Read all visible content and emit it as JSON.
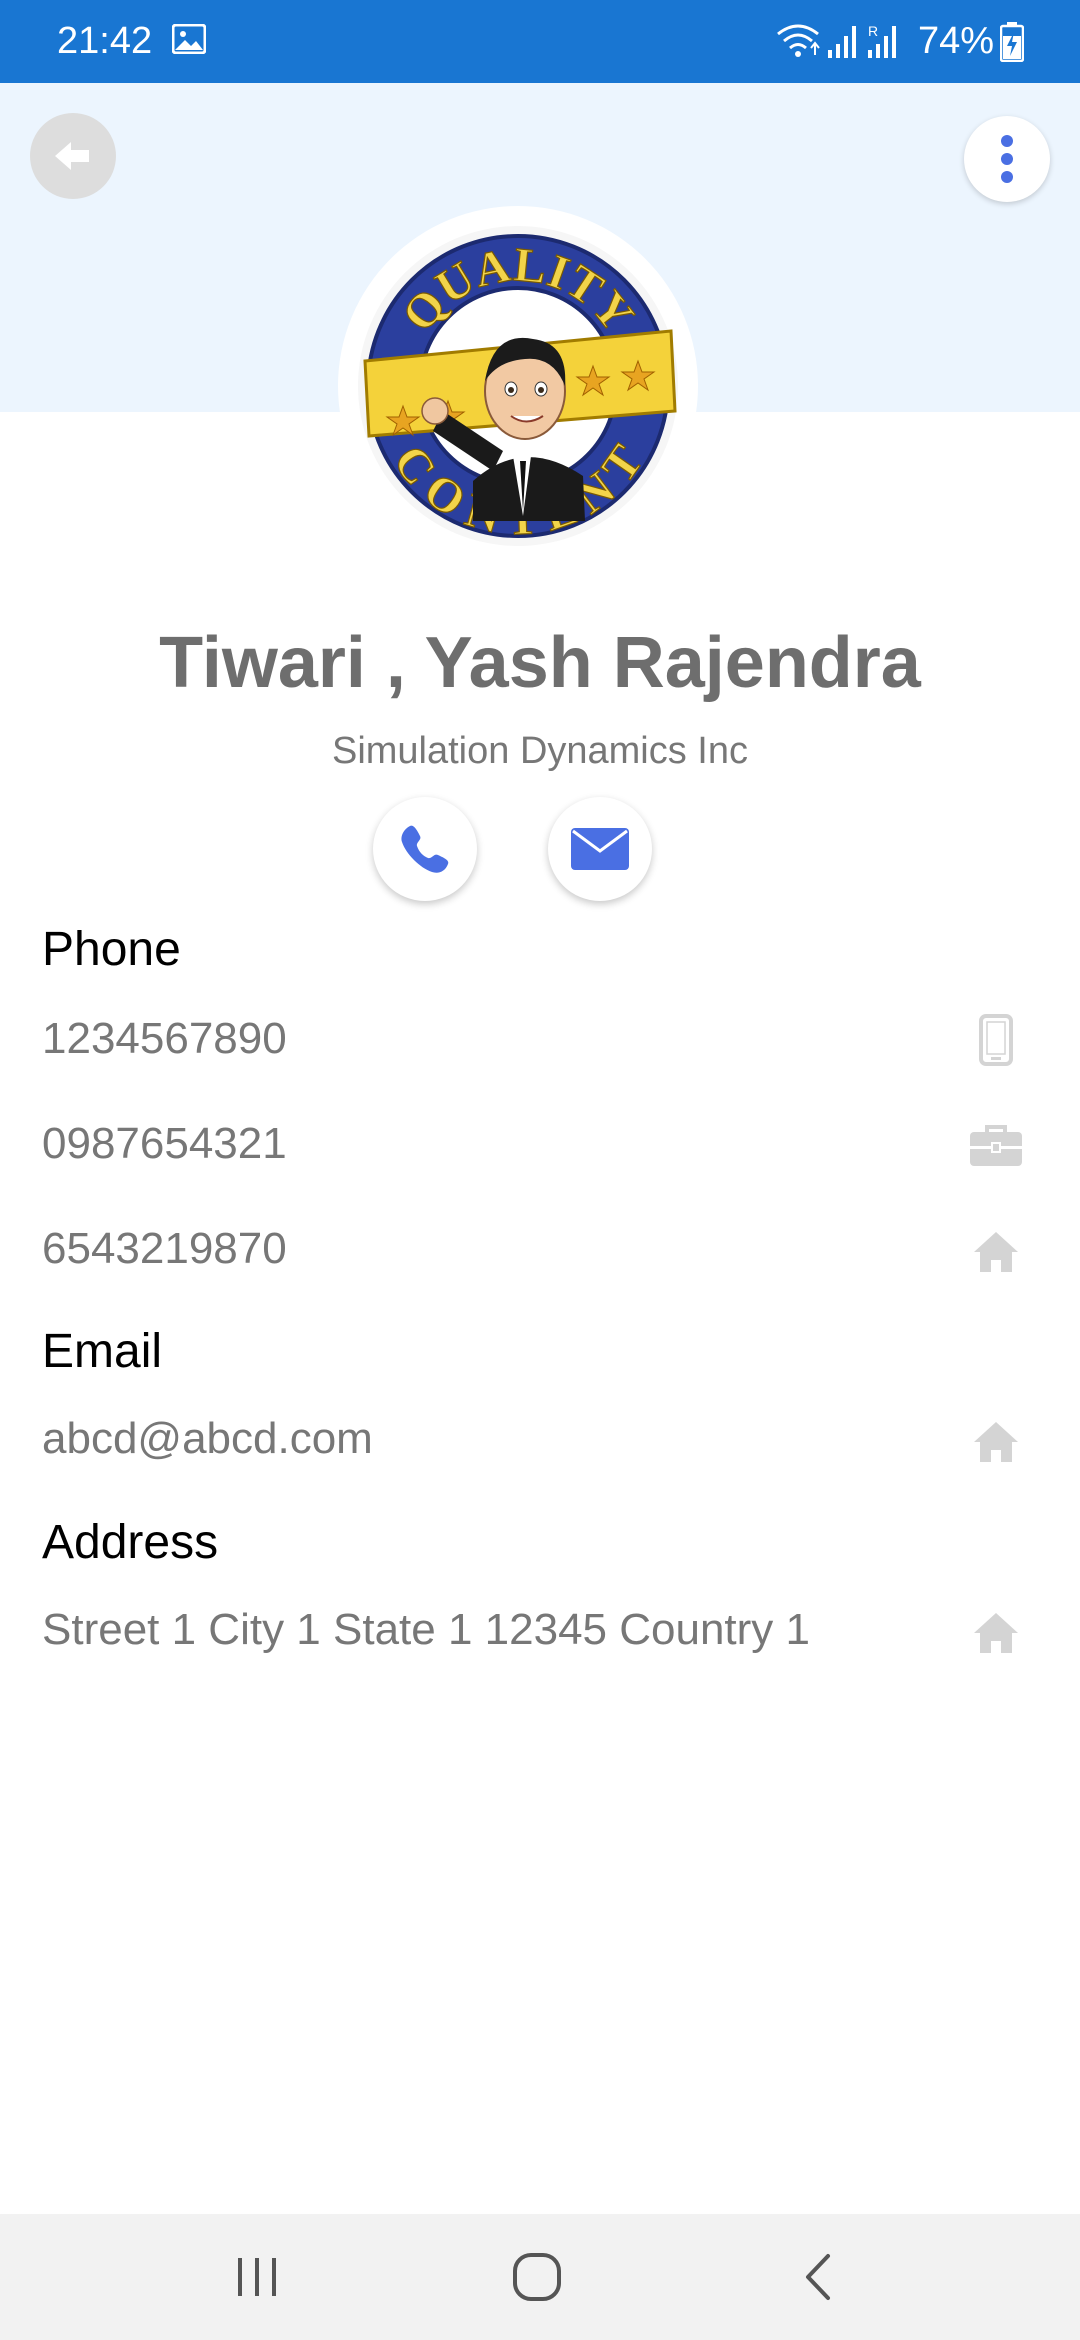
{
  "status_bar": {
    "time": "21:42",
    "battery": "74%",
    "icons": [
      "image-icon",
      "wifi-icon",
      "signal-icon",
      "signal-roaming-icon",
      "battery-charging-icon"
    ]
  },
  "colors": {
    "status_bar_bg": "#1976d2",
    "header_bg": "#ecf5fe",
    "accent": "#4a6fe3",
    "muted_text": "#777777",
    "row_icon": "#d4d4d4"
  },
  "header": {
    "back_icon": "arrow-left-icon",
    "menu_icon": "more-vert-icon",
    "avatar": "quality-content-badge-avatar"
  },
  "contact": {
    "name": "Tiwari , Yash Rajendra",
    "company": "Simulation Dynamics Inc"
  },
  "actions": {
    "call_icon": "phone-icon",
    "email_icon": "envelope-icon"
  },
  "phone": {
    "title": "Phone",
    "items": [
      {
        "value": "1234567890",
        "icon": "mobile-phone-icon"
      },
      {
        "value": "0987654321",
        "icon": "briefcase-icon"
      },
      {
        "value": "6543219870",
        "icon": "home-icon"
      }
    ]
  },
  "email": {
    "title": "Email",
    "items": [
      {
        "value": "abcd@abcd.com",
        "icon": "home-icon"
      }
    ]
  },
  "address": {
    "title": "Address",
    "items": [
      {
        "value": "Street 1 City 1 State 1 12345 Country 1",
        "icon": "home-icon"
      }
    ]
  },
  "nav_bar": {
    "icons": [
      "recents-icon",
      "home-circle-icon",
      "back-chevron-icon"
    ]
  }
}
